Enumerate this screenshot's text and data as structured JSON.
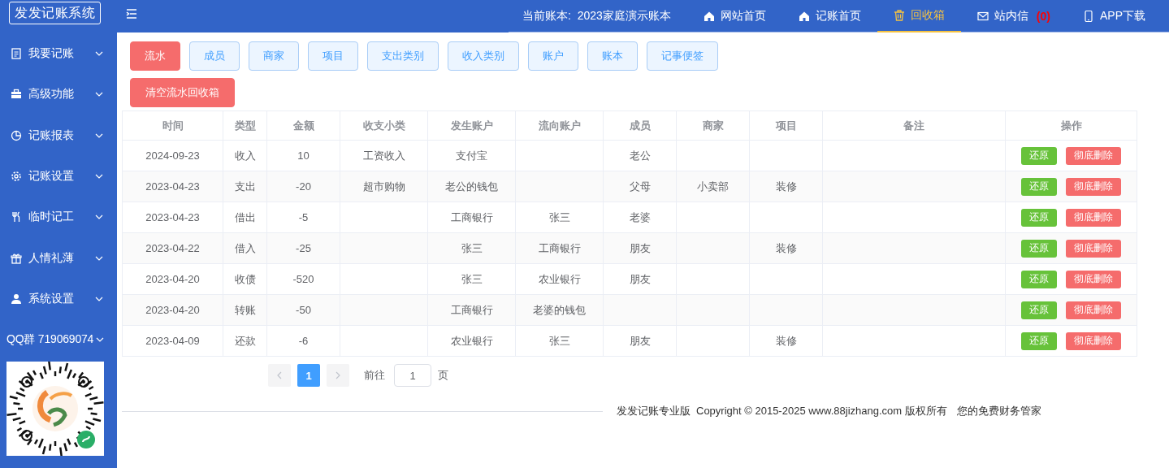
{
  "sidebar": {
    "logo": "发发记账系统",
    "menu": [
      {
        "label": "我要记账",
        "expanded": false
      },
      {
        "label": "高级功能",
        "expanded": false
      },
      {
        "label": "记账报表",
        "expanded": false
      },
      {
        "label": "记账设置",
        "expanded": false
      },
      {
        "label": "临时记工",
        "expanded": false
      },
      {
        "label": "人情礼薄",
        "expanded": false
      },
      {
        "label": "系统设置",
        "expanded": false
      },
      {
        "label": "QQ群 719069074",
        "expanded": false
      }
    ]
  },
  "topbar": {
    "current_book": "当前账本:  2023家庭演示账本",
    "nav": [
      {
        "label": "网站首页",
        "selected": false
      },
      {
        "label": "记账首页",
        "selected": false
      },
      {
        "label": "回收箱",
        "selected": true
      },
      {
        "label": "站内信",
        "selected": false,
        "count": "(0)"
      },
      {
        "label": "APP下载",
        "selected": false
      }
    ]
  },
  "tabs": [
    {
      "label": "流水",
      "selected": true
    },
    {
      "label": "成员",
      "selected": false
    },
    {
      "label": "商家",
      "selected": false
    },
    {
      "label": "项目",
      "selected": false
    },
    {
      "label": "支出类别",
      "selected": false
    },
    {
      "label": "收入类别",
      "selected": false
    },
    {
      "label": "账户",
      "selected": false
    },
    {
      "label": "账本",
      "selected": false
    },
    {
      "label": "记事便签",
      "selected": false
    }
  ],
  "clear_button": "清空流水回收箱",
  "table": {
    "columns": [
      "时间",
      "类型",
      "金额",
      "收支小类",
      "发生账户",
      "流向账户",
      "成员",
      "商家",
      "项目",
      "备注",
      "操作"
    ],
    "rows": [
      {
        "cells": [
          "2024-09-23",
          "收入",
          "10",
          "工资收入",
          "支付宝",
          "",
          "老公",
          "",
          "",
          ""
        ],
        "actions": [
          "还原",
          "彻底删除"
        ]
      },
      {
        "cells": [
          "2023-04-23",
          "支出",
          "-20",
          "超市购物",
          "老公的钱包",
          "",
          "父母",
          "小卖部",
          "装修",
          ""
        ],
        "actions": [
          "还原",
          "彻底删除"
        ]
      },
      {
        "cells": [
          "2023-04-23",
          "借出",
          "-5",
          "",
          "工商银行",
          "张三",
          "老婆",
          "",
          "",
          ""
        ],
        "actions": [
          "还原",
          "彻底删除"
        ]
      },
      {
        "cells": [
          "2023-04-22",
          "借入",
          "-25",
          "",
          "张三",
          "工商银行",
          "朋友",
          "",
          "装修",
          ""
        ],
        "actions": [
          "还原",
          "彻底删除"
        ]
      },
      {
        "cells": [
          "2023-04-20",
          "收债",
          "-520",
          "",
          "张三",
          "农业银行",
          "朋友",
          "",
          "",
          ""
        ],
        "actions": [
          "还原",
          "彻底删除"
        ]
      },
      {
        "cells": [
          "2023-04-20",
          "转账",
          "-50",
          "",
          "工商银行",
          "老婆的钱包",
          "",
          "",
          "",
          ""
        ],
        "actions": [
          "还原",
          "彻底删除"
        ]
      },
      {
        "cells": [
          "2023-04-09",
          "还款",
          "-6",
          "",
          "农业银行",
          "张三",
          "朋友",
          "",
          "装修",
          ""
        ],
        "actions": [
          "还原",
          "彻底删除"
        ]
      }
    ]
  },
  "pagination": {
    "pages": [
      {
        "label": "1",
        "selected": true
      }
    ],
    "goto_label": "前往",
    "goto_value": "1",
    "goto_suffix": "页"
  },
  "footer": [
    "发发记账专业版",
    "Copyright © 2015-2025 www.88jizhang.com 版权所有",
    "您的免费财务管家"
  ]
}
